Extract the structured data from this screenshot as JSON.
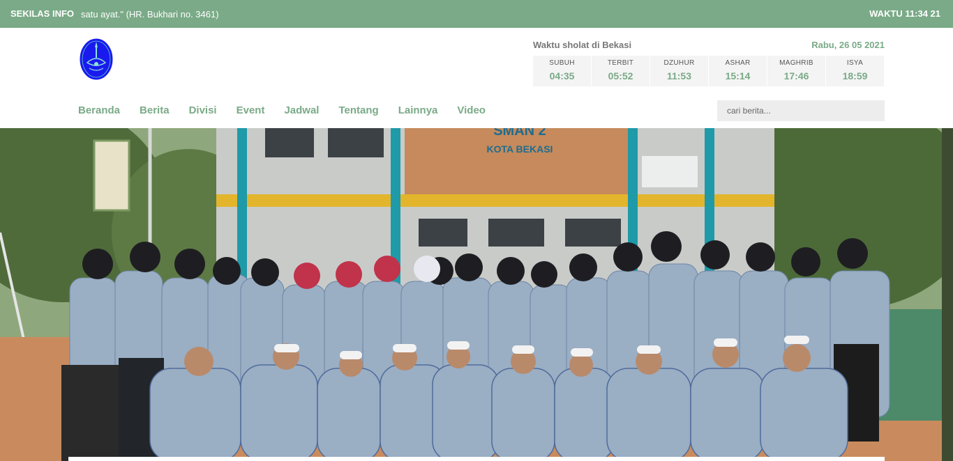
{
  "topbar": {
    "label": "SEKILAS INFO",
    "ticker": "satu ayat.\" (HR. Bukhari no. 3461)",
    "clock": "WAKTU 11:34 21"
  },
  "prayer": {
    "title": "Waktu sholat di Bekasi",
    "date": "Rabu, 26 05 2021",
    "times": [
      {
        "name": "SUBUH",
        "time": "04:35"
      },
      {
        "name": "TERBIT",
        "time": "05:52"
      },
      {
        "name": "DZUHUR",
        "time": "11:53"
      },
      {
        "name": "ASHAR",
        "time": "15:14"
      },
      {
        "name": "MAGHRIB",
        "time": "17:46"
      },
      {
        "name": "ISYA",
        "time": "18:59"
      }
    ]
  },
  "nav": {
    "items": [
      "Beranda",
      "Berita",
      "Divisi",
      "Event",
      "Jadwal",
      "Tentang",
      "Lainnya",
      "Video"
    ]
  },
  "search": {
    "placeholder": "cari berita..."
  },
  "hero": {
    "sign_line1": "SMAN 2",
    "sign_line2": "KOTA BEKASI"
  },
  "colors": {
    "accent": "#7aaa87",
    "logo_blue": "#1a1aef"
  }
}
